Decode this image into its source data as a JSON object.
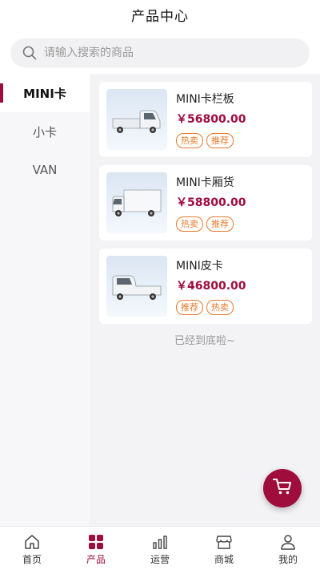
{
  "header": {
    "title": "产品中心"
  },
  "search": {
    "placeholder": "请输入搜索的商品"
  },
  "sidebar": {
    "items": [
      {
        "label": "MINI卡",
        "active": true
      },
      {
        "label": "小卡",
        "active": false
      },
      {
        "label": "VAN",
        "active": false
      }
    ]
  },
  "products": [
    {
      "name": "MINI卡栏板",
      "price": "￥56800.00",
      "tags": [
        "热卖",
        "推荐"
      ]
    },
    {
      "name": "MINI卡厢货",
      "price": "￥58800.00",
      "tags": [
        "热卖",
        "推荐"
      ]
    },
    {
      "name": "MINI皮卡",
      "price": "￥46800.00",
      "tags": [
        "推荐",
        "热卖"
      ]
    }
  ],
  "end_note": "已经到底啦~",
  "tabbar": {
    "items": [
      {
        "label": "首页",
        "icon": "home-icon",
        "active": false
      },
      {
        "label": "产品",
        "icon": "grid-icon",
        "active": true
      },
      {
        "label": "运营",
        "icon": "chart-icon",
        "active": false
      },
      {
        "label": "商城",
        "icon": "store-icon",
        "active": false
      },
      {
        "label": "我的",
        "icon": "user-icon",
        "active": false
      }
    ]
  },
  "colors": {
    "accent": "#9e0d3c",
    "tag": "#ea7a2c"
  }
}
